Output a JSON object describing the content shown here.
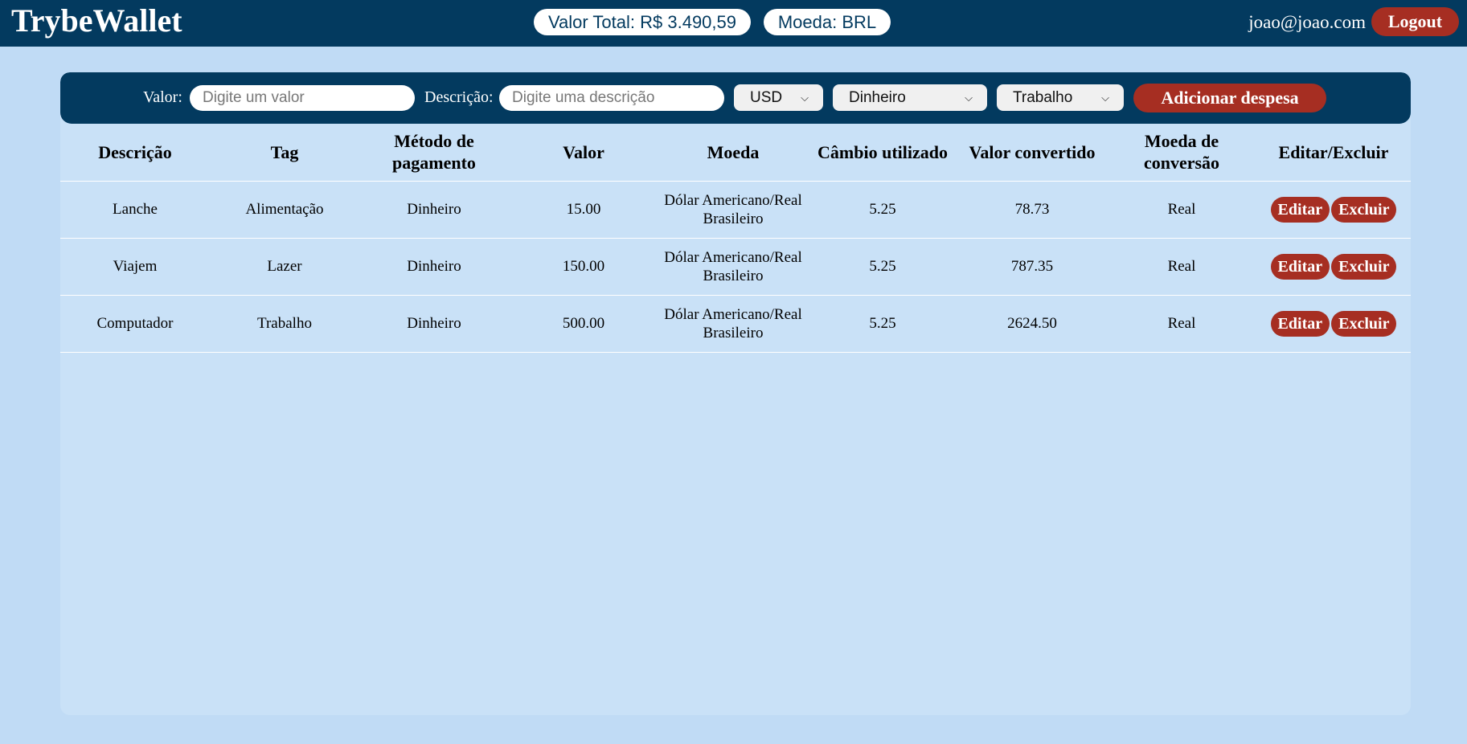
{
  "header": {
    "logo": "TrybeWallet",
    "total_label": "Valor Total: R$ 3.490,59",
    "currency_label": "Moeda: BRL",
    "email": "joao@joao.com",
    "logout_label": "Logout"
  },
  "form": {
    "valor_label": "Valor:",
    "valor_placeholder": "Digite um valor",
    "descricao_label": "Descrição:",
    "descricao_placeholder": "Digite uma descrição",
    "moeda_selected": "USD",
    "metodo_selected": "Dinheiro",
    "tag_selected": "Trabalho",
    "add_label": "Adicionar despesa"
  },
  "table": {
    "headers": [
      "Descrição",
      "Tag",
      "Método de pagamento",
      "Valor",
      "Moeda",
      "Câmbio utilizado",
      "Valor convertido",
      "Moeda de conversão",
      "Editar/Excluir"
    ],
    "rows": [
      [
        "Lanche",
        "Alimentação",
        "Dinheiro",
        "15.00",
        "Dólar Americano/Real Brasileiro",
        "5.25",
        "78.73",
        "Real"
      ],
      [
        "Viajem",
        "Lazer",
        "Dinheiro",
        "150.00",
        "Dólar Americano/Real Brasileiro",
        "5.25",
        "787.35",
        "Real"
      ],
      [
        "Computador",
        "Trabalho",
        "Dinheiro",
        "500.00",
        "Dólar Americano/Real Brasileiro",
        "5.25",
        "2624.50",
        "Real"
      ]
    ],
    "edit_label": "Editar",
    "delete_label": "Excluir"
  },
  "colors": {
    "header_bg": "#033a5f",
    "page_bg": "#c0dbf5",
    "panel_bg": "#c9e1f7",
    "accent_red": "#a62e22"
  },
  "icons": {
    "select_arrow": "chevron-down-icon"
  }
}
